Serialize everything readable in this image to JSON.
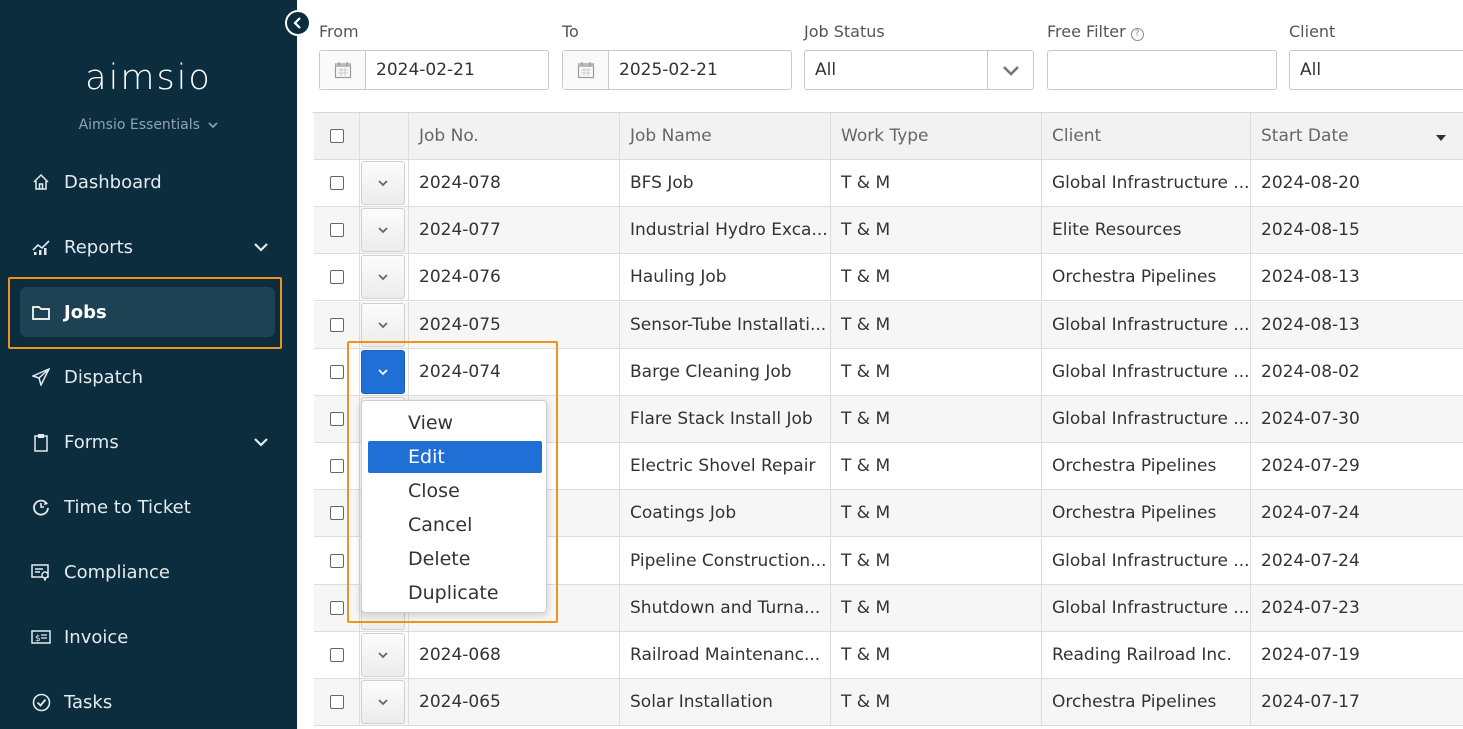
{
  "brand": {
    "logo": "aimsio",
    "edition": "Aimsio Essentials"
  },
  "nav": [
    {
      "label": "Dashboard",
      "icon": "home-icon",
      "has_chevron": false
    },
    {
      "label": "Reports",
      "icon": "chart-icon",
      "has_chevron": true
    },
    {
      "label": "Jobs",
      "icon": "folder-icon",
      "has_chevron": false,
      "active": true
    },
    {
      "label": "Dispatch",
      "icon": "paper-plane-icon",
      "has_chevron": false
    },
    {
      "label": "Forms",
      "icon": "clipboard-icon",
      "has_chevron": true
    },
    {
      "label": "Time to Ticket",
      "icon": "clock-arrow-icon",
      "has_chevron": false
    },
    {
      "label": "Compliance",
      "icon": "certificate-icon",
      "has_chevron": false
    },
    {
      "label": "Invoice",
      "icon": "invoice-icon",
      "has_chevron": false
    },
    {
      "label": "Tasks",
      "icon": "check-circle-icon",
      "has_chevron": false
    }
  ],
  "filters": {
    "from": {
      "label": "From",
      "value": "2024-02-21"
    },
    "to": {
      "label": "To",
      "value": "2025-02-21"
    },
    "job_status": {
      "label": "Job Status",
      "value": "All"
    },
    "free_filter": {
      "label": "Free Filter",
      "value": ""
    },
    "client": {
      "label": "Client",
      "value": "All"
    }
  },
  "table": {
    "headers": [
      "Job No.",
      "Job Name",
      "Work Type",
      "Client",
      "Start Date"
    ],
    "rows": [
      [
        "2024-078",
        "BFS Job",
        "T & M",
        "Global Infrastructure ...",
        "2024-08-20"
      ],
      [
        "2024-077",
        "Industrial Hydro Exca...",
        "T & M",
        "Elite Resources",
        "2024-08-15"
      ],
      [
        "2024-076",
        "Hauling Job",
        "T & M",
        "Orchestra Pipelines",
        "2024-08-13"
      ],
      [
        "2024-075",
        "Sensor-Tube Installati...",
        "T & M",
        "Global Infrastructure ...",
        "2024-08-13"
      ],
      [
        "2024-074",
        "Barge Cleaning Job",
        "T & M",
        "Global Infrastructure ...",
        "2024-08-02"
      ],
      [
        "",
        "Flare Stack Install Job",
        "T & M",
        "Global Infrastructure ...",
        "2024-07-30"
      ],
      [
        "",
        "Electric Shovel Repair",
        "T & M",
        "Orchestra Pipelines",
        "2024-07-29"
      ],
      [
        "",
        "Coatings Job",
        "T & M",
        "Orchestra Pipelines",
        "2024-07-24"
      ],
      [
        "",
        "Pipeline Construction...",
        "T & M",
        "Global Infrastructure ...",
        "2024-07-24"
      ],
      [
        "",
        "Shutdown and Turna...",
        "T & M",
        "Global Infrastructure ...",
        "2024-07-23"
      ],
      [
        "2024-068",
        "Railroad Maintenanc...",
        "T & M",
        "Reading Railroad Inc.",
        "2024-07-19"
      ],
      [
        "2024-065",
        "Solar Installation",
        "T & M",
        "Orchestra Pipelines",
        "2024-07-17"
      ]
    ]
  },
  "row_menu": {
    "items": [
      "View",
      "Edit",
      "Close",
      "Cancel",
      "Delete",
      "Duplicate"
    ],
    "selected": "Edit"
  },
  "colors": {
    "sidebar": "#0c2d3e",
    "accent": "#1f6fd6",
    "highlight": "#f0921e"
  }
}
